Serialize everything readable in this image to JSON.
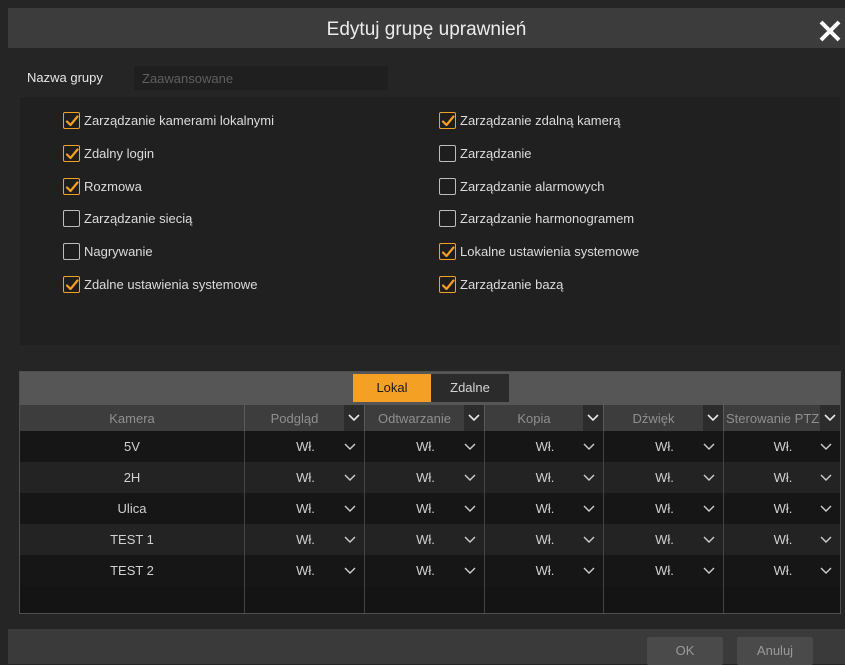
{
  "dialog": {
    "title": "Edytuj grupę uprawnień",
    "close_icon": "close-icon"
  },
  "group": {
    "name_label": "Nazwa grupy",
    "name_value": "",
    "name_placeholder": "Zaawansowane"
  },
  "permissions": {
    "left": [
      {
        "label": "Zarządzanie kamerami lokalnymi",
        "checked": true
      },
      {
        "label": "Zdalny login",
        "checked": true
      },
      {
        "label": "Rozmowa",
        "checked": true
      },
      {
        "label": "Zarządzanie siecią",
        "checked": false
      },
      {
        "label": "Nagrywanie",
        "checked": false
      },
      {
        "label": "Zdalne ustawienia systemowe",
        "checked": true
      }
    ],
    "right": [
      {
        "label": "Zarządzanie zdalną kamerą",
        "checked": true
      },
      {
        "label": "Zarządzanie",
        "checked": false
      },
      {
        "label": "Zarządzanie alarmowych",
        "checked": false
      },
      {
        "label": "Zarządzanie harmonogramem",
        "checked": false
      },
      {
        "label": "Lokalne ustawienia systemowe",
        "checked": true
      },
      {
        "label": "Zarządzanie bazą",
        "checked": true
      }
    ]
  },
  "tabs": {
    "local": "Lokal",
    "remote": "Zdalne",
    "active": "local"
  },
  "table": {
    "headers": {
      "camera": "Kamera",
      "preview": "Podgląd",
      "playback": "Odtwarzanie",
      "backup": "Kopia",
      "audio": "Dźwięk",
      "ptz": "Sterowanie PTZ"
    },
    "rows": [
      {
        "camera": "5V",
        "preview": "Wł.",
        "playback": "Wł.",
        "backup": "Wł.",
        "audio": "Wł.",
        "ptz": "Wł."
      },
      {
        "camera": "2H",
        "preview": "Wł.",
        "playback": "Wł.",
        "backup": "Wł.",
        "audio": "Wł.",
        "ptz": "Wł."
      },
      {
        "camera": "Ulica",
        "preview": "Wł.",
        "playback": "Wł.",
        "backup": "Wł.",
        "audio": "Wł.",
        "ptz": "Wł."
      },
      {
        "camera": "TEST 1",
        "preview": "Wł.",
        "playback": "Wł.",
        "backup": "Wł.",
        "audio": "Wł.",
        "ptz": "Wł."
      },
      {
        "camera": "TEST 2",
        "preview": "Wł.",
        "playback": "Wł.",
        "backup": "Wł.",
        "audio": "Wł.",
        "ptz": "Wł."
      }
    ]
  },
  "footer": {
    "ok": "OK",
    "cancel": "Anuluj"
  },
  "colors": {
    "accent": "#f4a024",
    "background": "#252525",
    "titlebar": "#3c3c3c"
  }
}
